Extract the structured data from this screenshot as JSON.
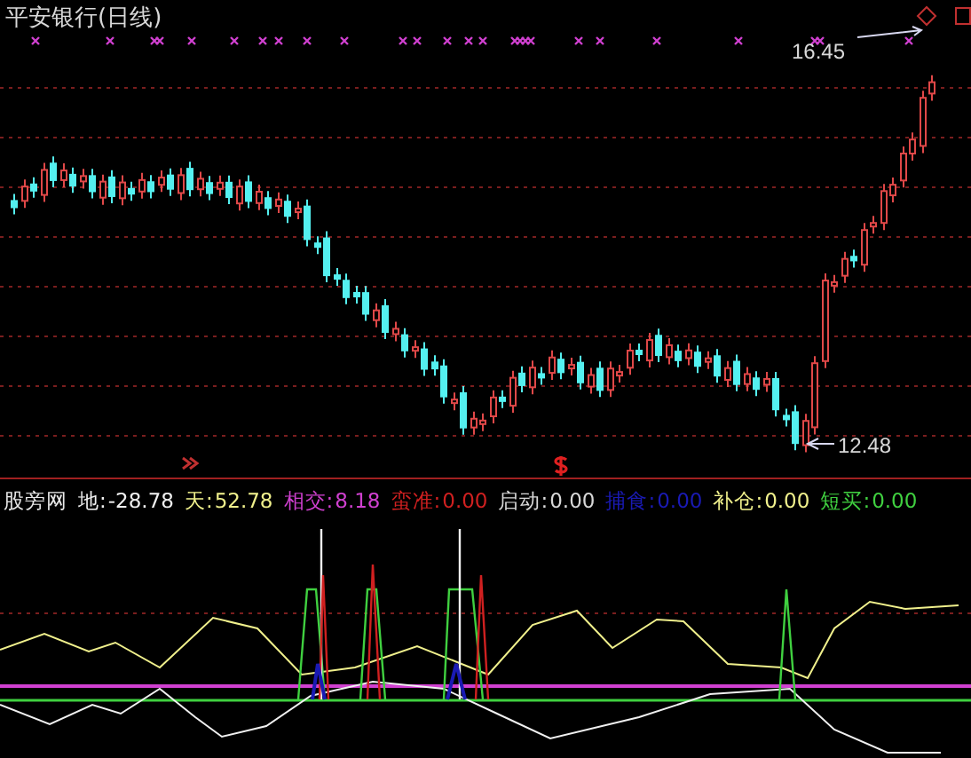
{
  "chart": {
    "title": "平安银行(日线)",
    "high_marker": "16.45",
    "low_marker": "12.48"
  },
  "indicator_legend": {
    "name": "股旁网",
    "items": [
      {
        "label": "地:",
        "value": "-28.78",
        "color": "#f0f0f0"
      },
      {
        "label": "天:",
        "value": "52.78",
        "color": "#f0f08c"
      },
      {
        "label": "相交:",
        "value": "8.18",
        "color": "#d040d0"
      },
      {
        "label": "蛮准:",
        "value": "0.00",
        "color": "#d02020"
      },
      {
        "label": "启动:",
        "value": "0.00",
        "color": "#d8d8d8"
      },
      {
        "label": "捕食:",
        "value": "0.00",
        "color": "#1a1ab4"
      },
      {
        "label": "补仓:",
        "value": "0.00",
        "color": "#f0f08c"
      },
      {
        "label": "短买:",
        "value": "0.00",
        "color": "#40d040"
      }
    ]
  }
}
